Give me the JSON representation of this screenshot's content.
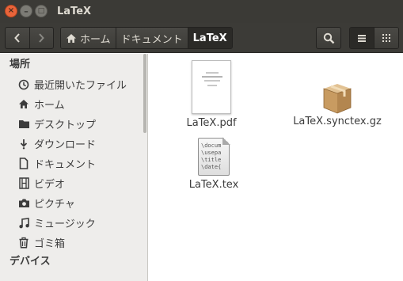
{
  "window": {
    "title": "LaTeX",
    "buttons": {
      "close": "×",
      "minimize": "–",
      "maximize": "□"
    }
  },
  "toolbar": {
    "back_icon": "chevron-left-icon",
    "forward_icon": "chevron-right-icon",
    "breadcrumbs": [
      {
        "label": "ホーム",
        "icon": "home-icon"
      },
      {
        "label": "ドキュメント"
      },
      {
        "label": "LaTeX",
        "active": true
      }
    ],
    "search_icon": "search-icon",
    "list_view_icon": "list-view-icon",
    "grid_view_icon": "grid-view-icon"
  },
  "sidebar": {
    "places_header": "場所",
    "items": [
      {
        "label": "最近開いたファイル",
        "icon": "clock-icon"
      },
      {
        "label": "ホーム",
        "icon": "home-icon"
      },
      {
        "label": "デスクトップ",
        "icon": "folder-icon"
      },
      {
        "label": "ダウンロード",
        "icon": "download-icon"
      },
      {
        "label": "ドキュメント",
        "icon": "document-icon"
      },
      {
        "label": "ビデオ",
        "icon": "film-icon"
      },
      {
        "label": "ピクチャ",
        "icon": "camera-icon"
      },
      {
        "label": "ミュージック",
        "icon": "music-icon"
      },
      {
        "label": "ゴミ箱",
        "icon": "trash-icon"
      }
    ],
    "devices_header": "デバイス"
  },
  "files": [
    {
      "name": "LaTeX.pdf",
      "type": "pdf"
    },
    {
      "name": "LaTeX.synctex.gz",
      "type": "archive"
    },
    {
      "name": "LaTeX.tex",
      "type": "tex",
      "preview": "\\docum\n\\usepa\n\\title\n\\date{"
    }
  ],
  "colors": {
    "titlebar": "#3b3a36",
    "close_button": "#e9643a",
    "sidebar_bg": "#eeedeb",
    "active_crumb": "#2b2a27"
  }
}
